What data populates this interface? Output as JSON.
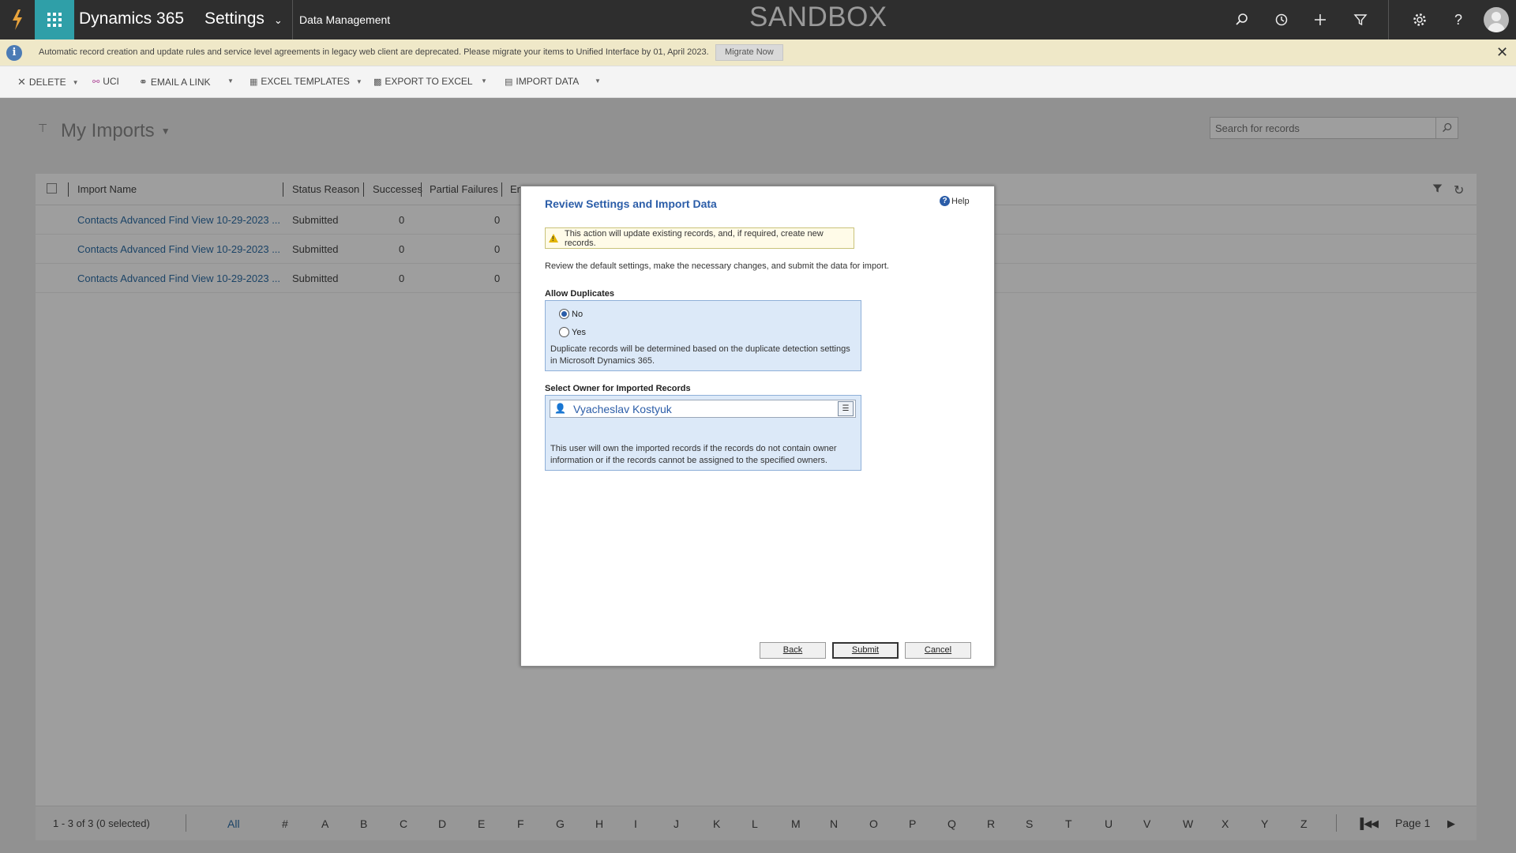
{
  "nav": {
    "product": "Dynamics 365",
    "area": "Settings",
    "breadcrumb": "Data Management",
    "environment": "SANDBOX",
    "icons": [
      "search-icon",
      "recent-icon",
      "new-icon",
      "advanced-find-icon",
      "settings-icon",
      "help-icon"
    ]
  },
  "notification": {
    "message": "Automatic record creation and update rules and service level agreements in legacy web client are deprecated. Please migrate your items to Unified Interface by 01, April 2023.",
    "button": "Migrate Now"
  },
  "commands": {
    "delete": "DELETE",
    "uci": "UCI",
    "email_link": "EMAIL A LINK",
    "excel_templates": "EXCEL TEMPLATES",
    "export_excel": "EXPORT TO EXCEL",
    "import_data": "IMPORT DATA"
  },
  "view": {
    "title": "My Imports",
    "search_placeholder": "Search for records"
  },
  "grid": {
    "columns": {
      "import_name": "Import Name",
      "status_reason": "Status Reason",
      "successes": "Successes",
      "partial_failures": "Partial Failures",
      "errors_partial": "Er"
    },
    "rows": [
      {
        "name": "Contacts Advanced Find View 10-29-2023 ...",
        "status": "Submitted",
        "successes": "0",
        "partial_failures": "0"
      },
      {
        "name": "Contacts Advanced Find View 10-29-2023 ...",
        "status": "Submitted",
        "successes": "0",
        "partial_failures": "0"
      },
      {
        "name": "Contacts Advanced Find View 10-29-2023 ...",
        "status": "Submitted",
        "successes": "0",
        "partial_failures": "0"
      }
    ]
  },
  "footer": {
    "count": "1 - 3 of 3 (0 selected)",
    "letters": [
      "All",
      "#",
      "A",
      "B",
      "C",
      "D",
      "E",
      "F",
      "G",
      "H",
      "I",
      "J",
      "K",
      "L",
      "M",
      "N",
      "O",
      "P",
      "Q",
      "R",
      "S",
      "T",
      "U",
      "V",
      "W",
      "X",
      "Y",
      "Z"
    ],
    "page": "Page 1"
  },
  "dialog": {
    "title": "Review Settings and Import Data",
    "help": "Help",
    "warning": "This action will update existing records, and, if required, create new records.",
    "intro": "Review the default settings, make the necessary changes, and submit the data for import.",
    "allow_duplicates": {
      "label": "Allow Duplicates",
      "options": [
        "No",
        "Yes"
      ],
      "selected": "No",
      "note": "Duplicate records will be determined based on the duplicate detection settings in Microsoft Dynamics 365."
    },
    "owner": {
      "label": "Select Owner for Imported Records",
      "value": "Vyacheslav Kostyuk",
      "note": "This user will own the imported records if the records do not contain owner information or if the records cannot be assigned to the specified owners."
    },
    "buttons": {
      "back": "Back",
      "submit": "Submit",
      "cancel": "Cancel"
    }
  }
}
